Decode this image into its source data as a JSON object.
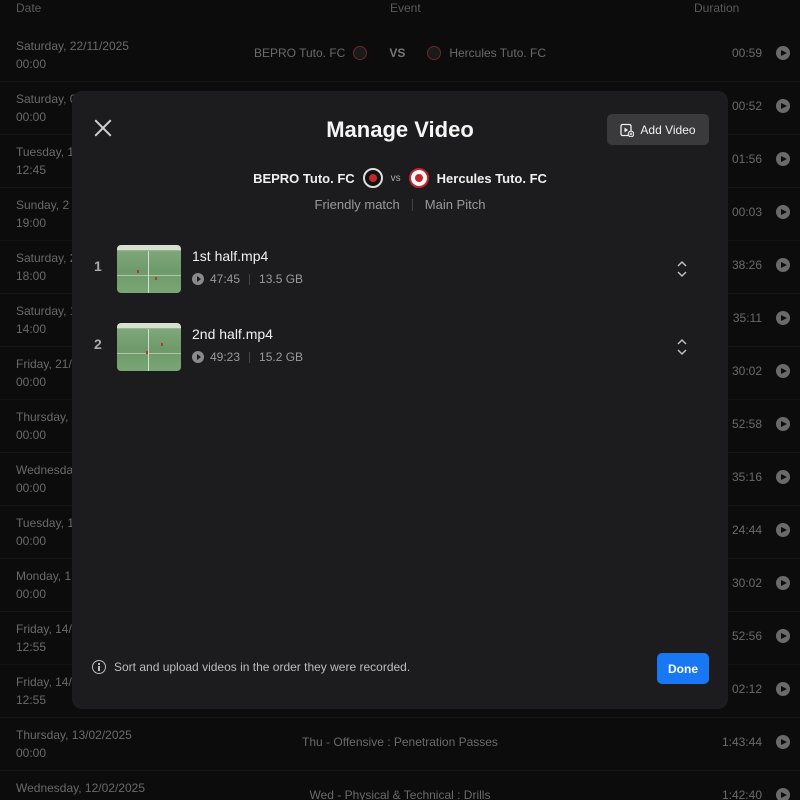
{
  "background": {
    "headers": {
      "date": "Date",
      "event": "Event",
      "duration": "Duration"
    },
    "rows": [
      {
        "date": "Saturday, 22/11/2025",
        "time": "00:00",
        "home": "BEPRO Tuto. FC",
        "vs": "VS",
        "away": "Hercules Tuto. FC",
        "duration": "00:59"
      },
      {
        "date": "Saturday, 0",
        "time": "00:00",
        "duration": "00:52"
      },
      {
        "date": "Tuesday, 1",
        "time": "12:45",
        "duration": "01:56"
      },
      {
        "date": "Sunday, 2",
        "time": "19:00",
        "duration": "00:03"
      },
      {
        "date": "Saturday, 2",
        "time": "18:00",
        "duration": "38:26"
      },
      {
        "date": "Saturday, 1",
        "time": "14:00",
        "duration": "35:11"
      },
      {
        "date": "Friday, 21/",
        "time": "00:00",
        "duration": "30:02"
      },
      {
        "date": "Thursday,",
        "time": "00:00",
        "duration": "52:58"
      },
      {
        "date": "Wednesda",
        "time": "00:00",
        "duration": "35:16"
      },
      {
        "date": "Tuesday, 1",
        "time": "00:00",
        "duration": "24:44"
      },
      {
        "date": "Monday, 1",
        "time": "00:00",
        "duration": "30:02"
      },
      {
        "date": "Friday, 14/",
        "time": "12:55",
        "duration": "52:56"
      },
      {
        "date": "Friday, 14/",
        "time": "12:55",
        "duration": "02:12"
      },
      {
        "date": "Thursday, 13/02/2025",
        "time": "00:00",
        "event": "Thu - Offensive : Penetration Passes",
        "duration": "1:43:44"
      },
      {
        "date": "Wednesday, 12/02/2025",
        "time": "",
        "event": "Wed - Physical & Technical : Drills",
        "duration": "1:42:40"
      }
    ]
  },
  "modal": {
    "title": "Manage Video",
    "add_video_label": "Add Video",
    "home_team": "BEPRO Tuto. FC",
    "vs": "vs",
    "away_team": "Hercules Tuto. FC",
    "match_type": "Friendly match",
    "venue": "Main Pitch",
    "videos": [
      {
        "index": "1",
        "name": "1st half.mp4",
        "duration": "47:45",
        "size": "13.5 GB"
      },
      {
        "index": "2",
        "name": "2nd half.mp4",
        "duration": "49:23",
        "size": "15.2 GB"
      }
    ],
    "footer_note": "Sort and upload videos in the order they were recorded.",
    "done_label": "Done"
  },
  "colors": {
    "accent": "#1877f2",
    "modal_bg": "#1c1c1e",
    "page_bg": "#0c0c0c"
  }
}
